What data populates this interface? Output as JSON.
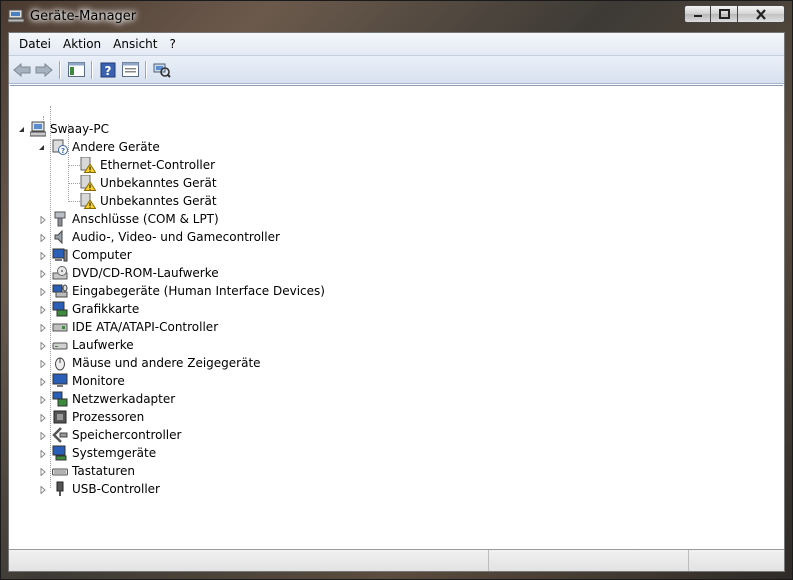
{
  "window": {
    "title": "Geräte-Manager"
  },
  "menu": [
    "Datei",
    "Aktion",
    "Ansicht",
    "?"
  ],
  "tree": {
    "root": {
      "label": "Swaay-PC"
    },
    "categories": [
      {
        "label": "Andere Geräte",
        "icon": "unknown-device-icon",
        "expanded": true,
        "children": [
          "Ethernet-Controller",
          "Unbekanntes Gerät",
          "Unbekanntes Gerät"
        ]
      },
      {
        "label": "Anschlüsse (COM & LPT)",
        "icon": "port-icon"
      },
      {
        "label": "Audio-, Video- und Gamecontroller",
        "icon": "speaker-icon"
      },
      {
        "label": "Computer",
        "icon": "computer-icon"
      },
      {
        "label": "DVD/CD-ROM-Laufwerke",
        "icon": "dvd-drive-icon"
      },
      {
        "label": "Eingabegeräte (Human Interface Devices)",
        "icon": "hid-icon"
      },
      {
        "label": "Grafikkarte",
        "icon": "display-adapter-icon"
      },
      {
        "label": "IDE ATA/ATAPI-Controller",
        "icon": "ide-controller-icon"
      },
      {
        "label": "Laufwerke",
        "icon": "disk-drive-icon"
      },
      {
        "label": "Mäuse und andere Zeigegeräte",
        "icon": "mouse-icon"
      },
      {
        "label": "Monitore",
        "icon": "monitor-icon"
      },
      {
        "label": "Netzwerkadapter",
        "icon": "network-adapter-icon"
      },
      {
        "label": "Prozessoren",
        "icon": "processor-icon"
      },
      {
        "label": "Speichercontroller",
        "icon": "storage-controller-icon"
      },
      {
        "label": "Systemgeräte",
        "icon": "system-device-icon"
      },
      {
        "label": "Tastaturen",
        "icon": "keyboard-icon"
      },
      {
        "label": "USB-Controller",
        "icon": "usb-icon"
      }
    ]
  }
}
